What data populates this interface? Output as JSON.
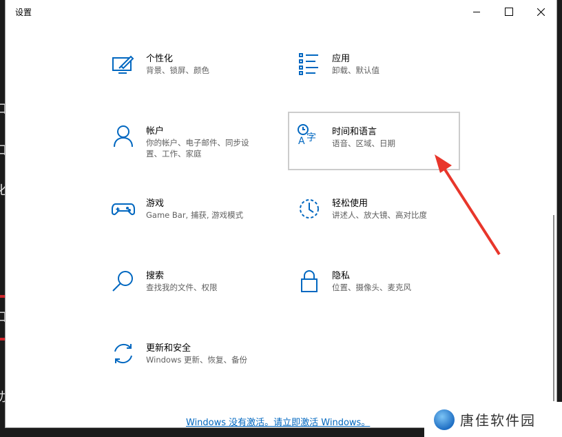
{
  "window": {
    "title": "设置"
  },
  "tiles": [
    {
      "name": "个性化",
      "desc": "背景、锁屏、颜色",
      "icon": "personalization-icon"
    },
    {
      "name": "应用",
      "desc": "卸载、默认值",
      "icon": "apps-icon"
    },
    {
      "name": "帐户",
      "desc": "你的帐户、电子邮件、同步设置、工作、家庭",
      "icon": "accounts-icon"
    },
    {
      "name": "时间和语言",
      "desc": "语音、区域、日期",
      "icon": "time-language-icon"
    },
    {
      "name": "游戏",
      "desc": "Game Bar, 捕获, 游戏模式",
      "icon": "gaming-icon"
    },
    {
      "name": "轻松使用",
      "desc": "讲述人、放大镜、高对比度",
      "icon": "ease-of-access-icon"
    },
    {
      "name": "搜索",
      "desc": "查找我的文件、权限",
      "icon": "search-icon"
    },
    {
      "name": "隐私",
      "desc": "位置、摄像头、麦克风",
      "icon": "privacy-lock-icon"
    },
    {
      "name": "更新和安全",
      "desc": "Windows 更新、恢复、备份",
      "icon": "update-security-icon"
    }
  ],
  "activation": "Windows 没有激活。请立即激活 Windows。",
  "watermark": "唐佳软件园",
  "colors": {
    "accent": "#0067c0",
    "arrow": "#e8362b"
  }
}
